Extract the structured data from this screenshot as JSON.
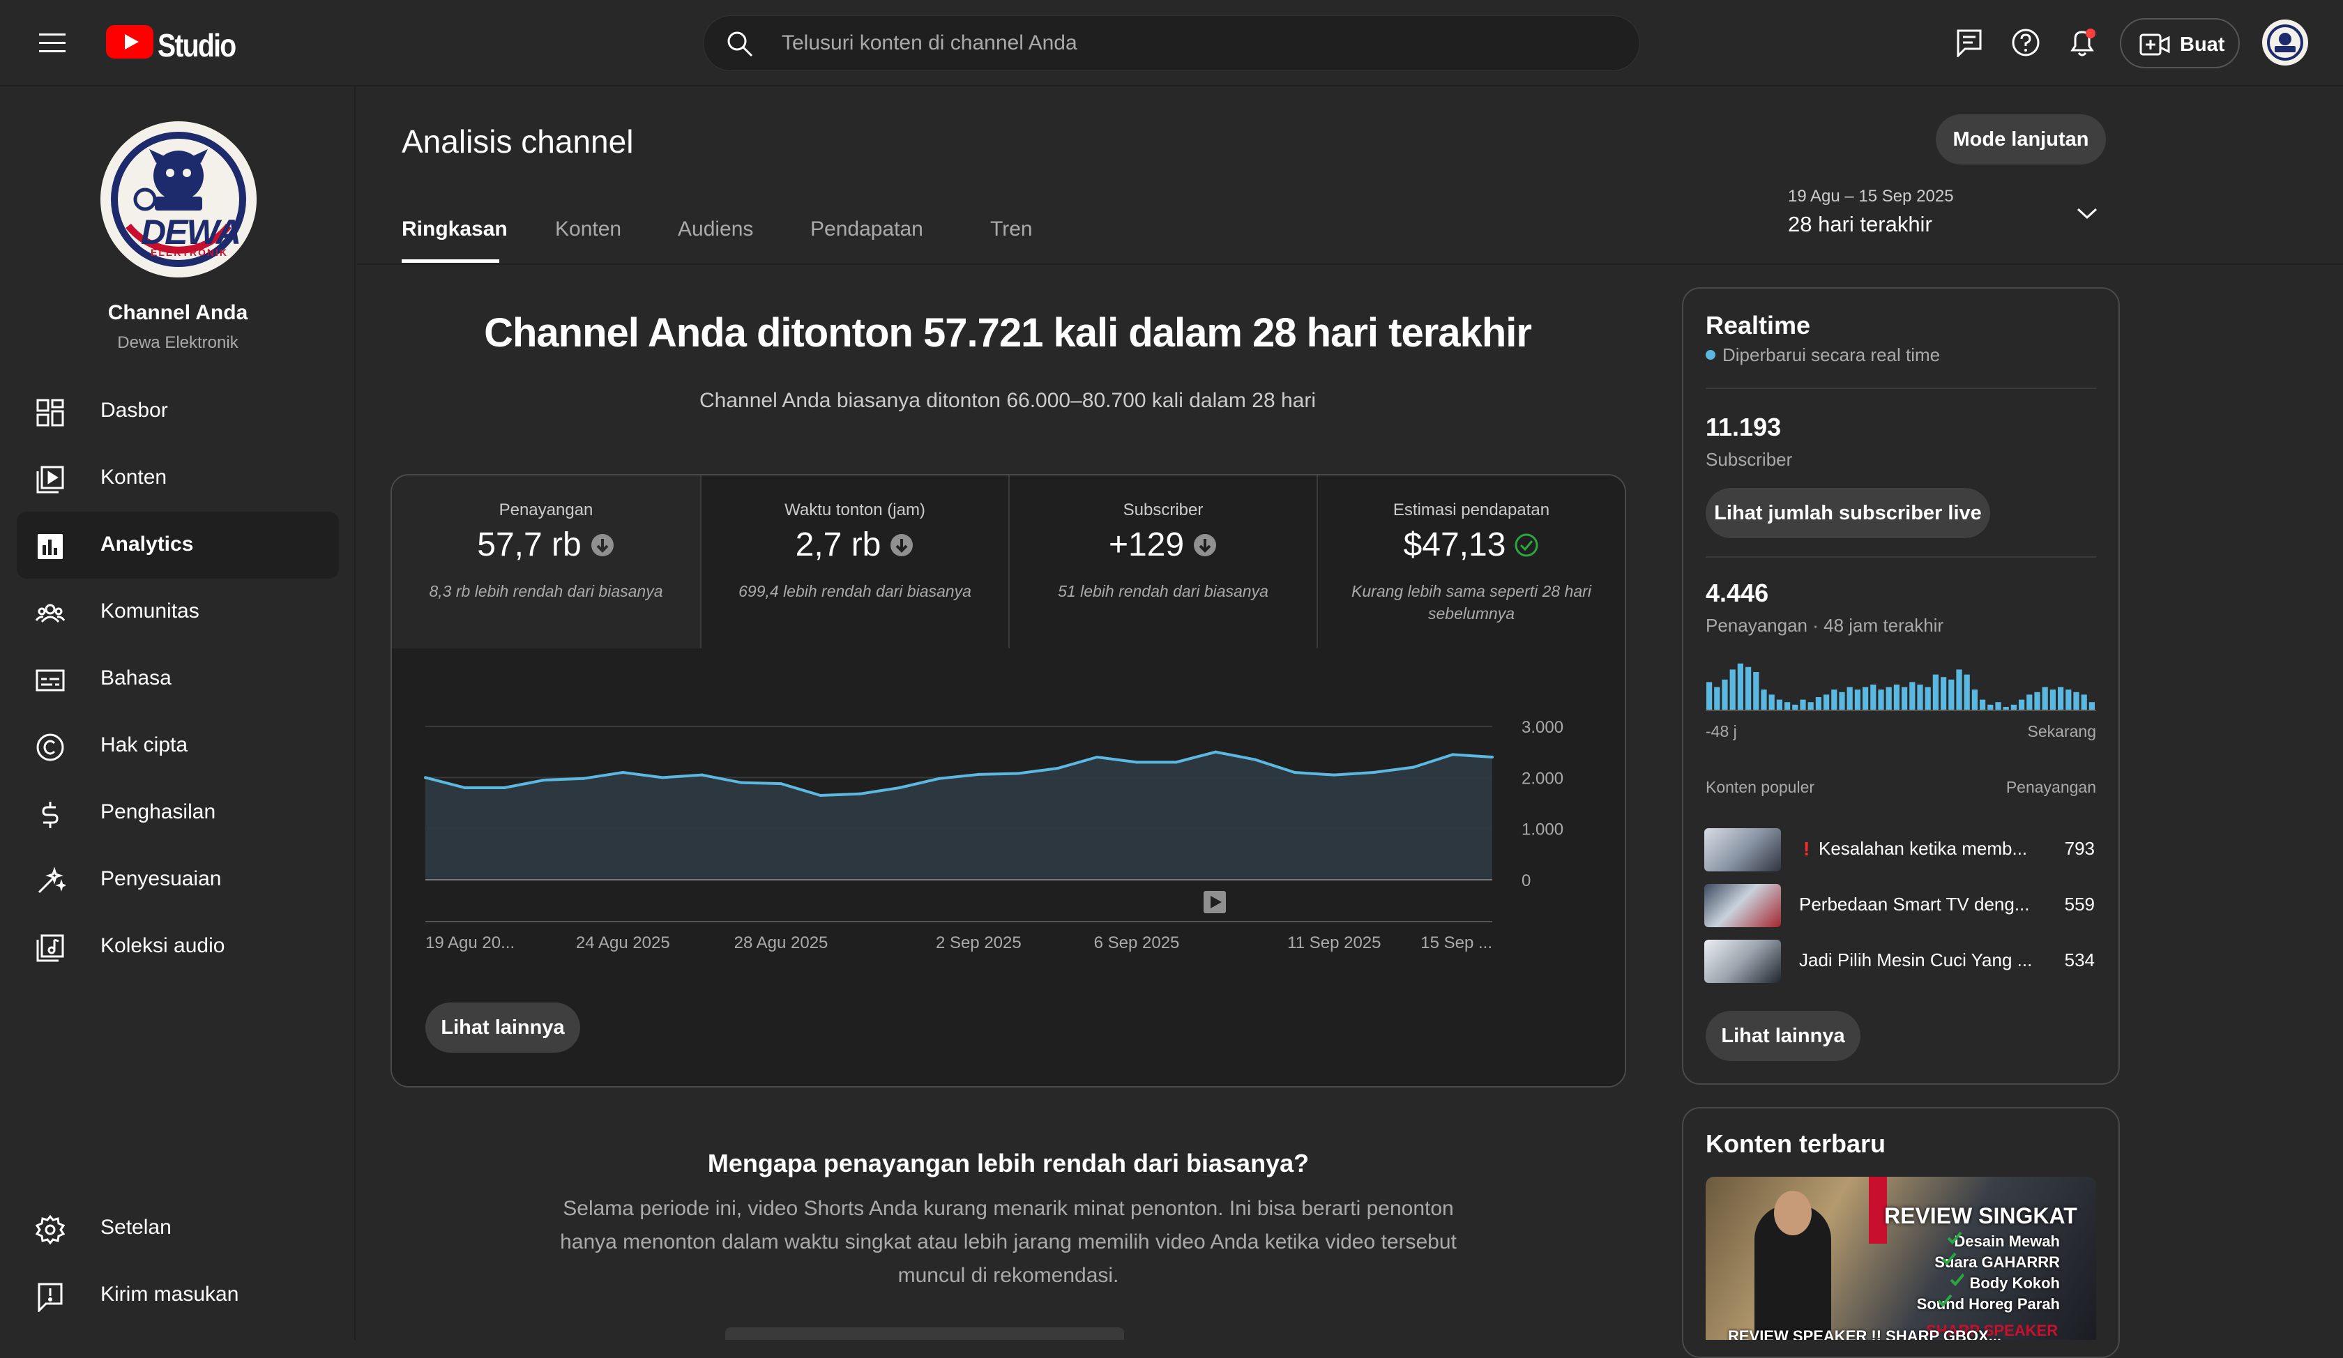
{
  "topbar": {
    "logo_text": "Studio",
    "search_placeholder": "Telusuri konten di channel Anda",
    "create_label": "Buat"
  },
  "channel": {
    "label": "Channel Anda",
    "name": "Dewa Elektronik",
    "avatar_text": "DEWA",
    "avatar_subtext": "ELEKTRONIK"
  },
  "sidebar": {
    "items": [
      {
        "label": "Dasbor",
        "icon": "dashboard-icon"
      },
      {
        "label": "Konten",
        "icon": "content-icon"
      },
      {
        "label": "Analytics",
        "icon": "analytics-icon"
      },
      {
        "label": "Komunitas",
        "icon": "community-icon"
      },
      {
        "label": "Bahasa",
        "icon": "subtitles-icon"
      },
      {
        "label": "Hak cipta",
        "icon": "copyright-icon"
      },
      {
        "label": "Penghasilan",
        "icon": "dollar-icon"
      },
      {
        "label": "Penyesuaian",
        "icon": "magic-wand-icon"
      },
      {
        "label": "Koleksi audio",
        "icon": "audio-library-icon"
      }
    ],
    "bottom": [
      {
        "label": "Setelan",
        "icon": "gear-icon"
      },
      {
        "label": "Kirim masukan",
        "icon": "feedback-icon"
      }
    ]
  },
  "page": {
    "title": "Analisis channel",
    "advanced_mode": "Mode lanjutan",
    "tabs": [
      "Ringkasan",
      "Konten",
      "Audiens",
      "Pendapatan",
      "Tren"
    ],
    "active_tab": "Ringkasan",
    "date_range": "19 Agu – 15 Sep 2025",
    "date_label": "28 hari terakhir"
  },
  "summary": {
    "headline": "Channel Anda ditonton 57.721 kali dalam 28 hari terakhir",
    "subline": "Channel Anda biasanya ditonton 66.000–80.700 kali dalam 28 hari"
  },
  "metrics": [
    {
      "label": "Penayangan",
      "value": "57,7 rb",
      "status": "down",
      "note": "8,3 rb lebih rendah dari biasanya"
    },
    {
      "label": "Waktu tonton (jam)",
      "value": "2,7 rb",
      "status": "down",
      "note": "699,4 lebih rendah dari biasanya"
    },
    {
      "label": "Subscriber",
      "value": "+129",
      "status": "down",
      "note": "51 lebih rendah dari biasanya"
    },
    {
      "label": "Estimasi pendapatan",
      "value": "$47,13",
      "status": "ok",
      "note": "Kurang lebih sama seperti 28 hari sebelumnya"
    }
  ],
  "chart_data": {
    "type": "area",
    "x_tick_labels": [
      "19 Agu 20...",
      "24 Agu 2025",
      "28 Agu 2025",
      "2 Sep 2025",
      "6 Sep 2025",
      "11 Sep 2025",
      "15 Sep ..."
    ],
    "yticks": [
      "3.000",
      "2.000",
      "1.000",
      "0"
    ],
    "ylim": [
      0,
      3000
    ],
    "series": [
      {
        "values": [
          2000,
          1800,
          1800,
          1950,
          1980,
          2100,
          2000,
          2050,
          1900,
          1880,
          1650,
          1680,
          1800,
          1980,
          2060,
          2080,
          2180,
          2400,
          2300,
          2300,
          2500,
          2350,
          2100,
          2050,
          2100,
          2200,
          2450,
          2400
        ]
      }
    ],
    "color": "#5bb8e0",
    "see_more": "Lihat lainnya"
  },
  "explanation": {
    "title": "Mengapa penayangan lebih rendah dari biasanya?",
    "body": "Selama periode ini, video Shorts Anda kurang menarik minat penonton. Ini bisa berarti penonton hanya menonton dalam waktu singkat atau lebih jarang memilih video Anda ketika video tersebut muncul di rekomendasi."
  },
  "realtime": {
    "title": "Realtime",
    "status": "Diperbarui secara real time",
    "subscribers": "11.193",
    "subscribers_label": "Subscriber",
    "live_button": "Lihat jumlah subscriber live",
    "views": "4.446",
    "views_label": "Penayangan · 48 jam terakhir",
    "bars": [
      0.55,
      0.45,
      0.6,
      0.8,
      0.92,
      0.85,
      0.75,
      0.4,
      0.3,
      0.2,
      0.15,
      0.1,
      0.2,
      0.15,
      0.25,
      0.3,
      0.4,
      0.35,
      0.45,
      0.4,
      0.45,
      0.5,
      0.4,
      0.45,
      0.5,
      0.45,
      0.55,
      0.5,
      0.45,
      0.7,
      0.65,
      0.6,
      0.8,
      0.7,
      0.4,
      0.2,
      0.1,
      0.15,
      0.05,
      0.1,
      0.2,
      0.3,
      0.35,
      0.45,
      0.4,
      0.45,
      0.4,
      0.35,
      0.3,
      0.15
    ],
    "axis_left": "-48 j",
    "axis_right": "Sekarang",
    "popular_label": "Konten populer",
    "popular_metric": "Penayangan",
    "popular": [
      {
        "title": "Kesalahan ketika memb...",
        "views": "793",
        "alert": "!"
      },
      {
        "title": "Perbedaan Smart TV deng...",
        "views": "559"
      },
      {
        "title": "Jadi Pilih Mesin Cuci Yang ...",
        "views": "534"
      }
    ],
    "see_more": "Lihat lainnya"
  },
  "latest": {
    "title": "Konten terbaru",
    "thumb_heading": "REVIEW SINGKAT",
    "thumb_lines": [
      "Desain Mewah",
      "Suara GAHARRR",
      "Body Kokoh",
      "Sound Horeg Parah"
    ],
    "thumb_footer": "REVIEW SPEAKER !! SHARP GBOX...",
    "thumb_brand": "SHARP SPEAKER"
  }
}
